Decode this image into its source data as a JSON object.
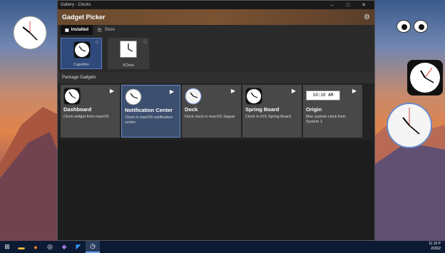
{
  "window": {
    "titlebar_text": "Gallery - Clocks",
    "minimize": "–",
    "maximize": "□",
    "close": "✕"
  },
  "header": {
    "title": "Gadget Picker",
    "settings_icon": "gear-icon"
  },
  "tabs": [
    {
      "label": "Installed",
      "active": true,
      "icon": "grid-icon"
    },
    {
      "label": "Store",
      "active": false,
      "icon": "store-icon"
    }
  ],
  "installed": [
    {
      "label": "Cupertino",
      "selected": true
    },
    {
      "label": "XClock",
      "selected": false
    }
  ],
  "section": {
    "package_gadgets": "Package Gadgets"
  },
  "cards": [
    {
      "title": "Dashboard",
      "desc": "Clock widget from macOS",
      "icon": "dashboard-clock"
    },
    {
      "title": "Notification Center",
      "desc": "Clock in macOS notification center",
      "icon": "analog-clock"
    },
    {
      "title": "Dock",
      "desc": "Dock clock in macOS Jaguar",
      "icon": "analog-clock"
    },
    {
      "title": "Spring Board",
      "desc": "Clock in iOS Spring Board",
      "icon": "ios-clock"
    },
    {
      "title": "Origin",
      "desc": "Mac system clock from System 1",
      "badge": "10:10 AM"
    }
  ],
  "taskbar": {
    "time": "11:16 P",
    "date": "2/20/2"
  },
  "colors": {
    "accent": "#2f4a7a",
    "header_brown": "#7a5232",
    "taskbar": "#0c1a33"
  }
}
